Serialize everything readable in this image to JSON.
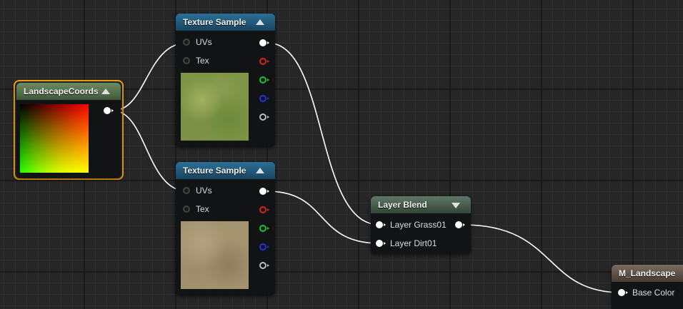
{
  "nodes": {
    "landscape_coords": {
      "title": "LandscapeCoords"
    },
    "texture_sample_top": {
      "title": "Texture Sample",
      "inputs": [
        "UVs",
        "Tex"
      ]
    },
    "texture_sample_bottom": {
      "title": "Texture Sample",
      "inputs": [
        "UVs",
        "Tex"
      ]
    },
    "layer_blend": {
      "title": "Layer Blend",
      "inputs": [
        "Layer Grass01",
        "Layer Dirt01"
      ]
    },
    "material": {
      "title": "M_Landscape",
      "inputs": [
        "Base Color"
      ]
    }
  },
  "colors": {
    "texture_header": "#2d6f96",
    "coords_header": "#6d8a63",
    "selection": "#f2a10f",
    "pin_rgba": "#ffffff",
    "pin_r": "#e0201e",
    "pin_g": "#22c22a",
    "pin_b": "#2436d8",
    "pin_a": "#bbbbbb",
    "wire": "#ffffff"
  },
  "icons": {
    "collapse_up": "triangle-up",
    "collapse_down": "triangle-down"
  }
}
